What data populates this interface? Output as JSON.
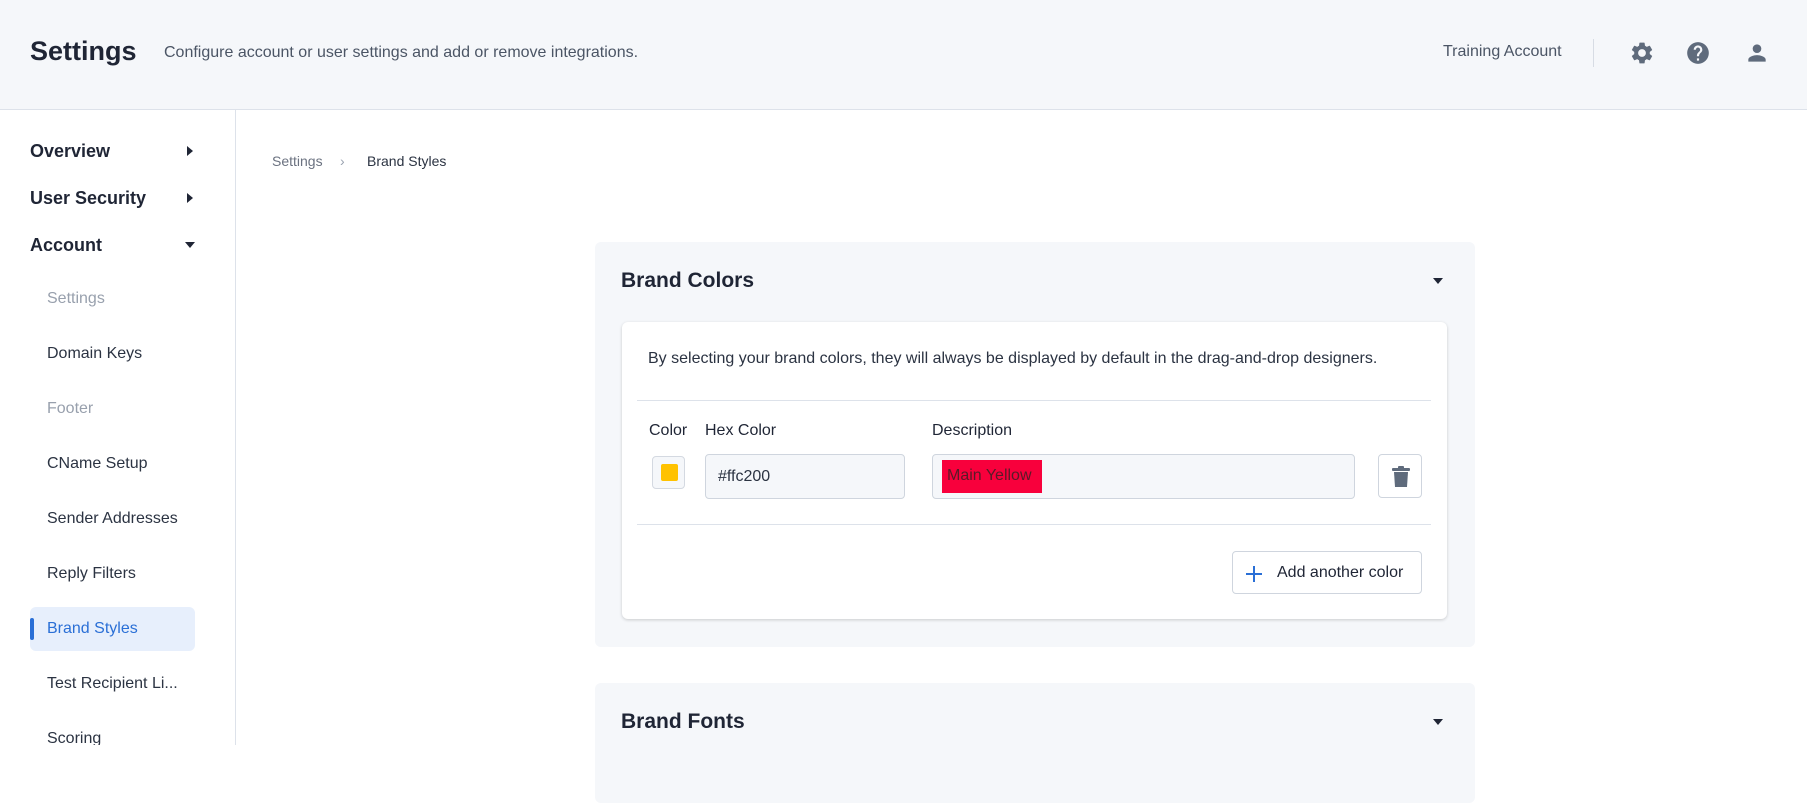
{
  "header": {
    "title": "Settings",
    "subtitle": "Configure account or user settings and add or remove integrations.",
    "account_name": "Training Account",
    "icons": [
      "gear-icon",
      "help-icon",
      "user-icon"
    ]
  },
  "sidebar": {
    "sections": [
      {
        "label": "Overview",
        "expanded": false
      },
      {
        "label": "User Security",
        "expanded": false
      },
      {
        "label": "Account",
        "expanded": true
      }
    ],
    "items": [
      {
        "label": "Settings",
        "state": "disabled"
      },
      {
        "label": "Domain Keys",
        "state": "normal"
      },
      {
        "label": "Footer",
        "state": "disabled"
      },
      {
        "label": "CName Setup",
        "state": "normal"
      },
      {
        "label": "Sender Addresses",
        "state": "normal"
      },
      {
        "label": "Reply Filters",
        "state": "normal"
      },
      {
        "label": "Brand Styles",
        "state": "active"
      },
      {
        "label": "Test Recipient Li...",
        "state": "normal"
      },
      {
        "label": "Scoring",
        "state": "normal"
      }
    ]
  },
  "breadcrumb": {
    "parent": "Settings",
    "separator": "›",
    "current": "Brand Styles"
  },
  "brand_colors": {
    "title": "Brand Colors",
    "intro": "By selecting your brand colors, they will always be displayed by default in the drag-and-drop designers.",
    "columns": {
      "color": "Color",
      "hex": "Hex Color",
      "description": "Description"
    },
    "rows": [
      {
        "swatch": "#ffc200",
        "hex": "#ffc200",
        "description": "Main Yellow"
      }
    ],
    "add_label": "Add another color"
  },
  "brand_fonts": {
    "title": "Brand Fonts"
  },
  "colors": {
    "accent": "#2a6fd6",
    "highlight": "#f8003c",
    "icon": "#5f6b7c"
  }
}
